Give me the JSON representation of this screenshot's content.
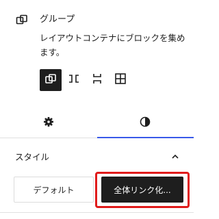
{
  "block": {
    "icon": "group-icon",
    "title": "グループ",
    "description": "レイアウトコンテナにブロックを集めます。"
  },
  "variations": [
    {
      "name": "group",
      "icon": "group-icon",
      "active": true
    },
    {
      "name": "row",
      "icon": "row-icon",
      "active": false
    },
    {
      "name": "stack",
      "icon": "stack-icon",
      "active": false
    },
    {
      "name": "grid",
      "icon": "grid-icon",
      "active": false
    }
  ],
  "tabs": [
    {
      "name": "settings",
      "icon": "gear-icon",
      "active": false
    },
    {
      "name": "styles",
      "icon": "contrast-icon",
      "active": true
    }
  ],
  "styles_panel": {
    "title": "スタイル",
    "expanded": true,
    "options": [
      {
        "label": "デフォルト",
        "active": false
      },
      {
        "label": "全体リンク化...",
        "active": true
      }
    ]
  },
  "colors": {
    "active_tab_underline": "#3858e9",
    "highlight_border": "#e01b1b",
    "active_button_bg": "#1e1e1e"
  }
}
